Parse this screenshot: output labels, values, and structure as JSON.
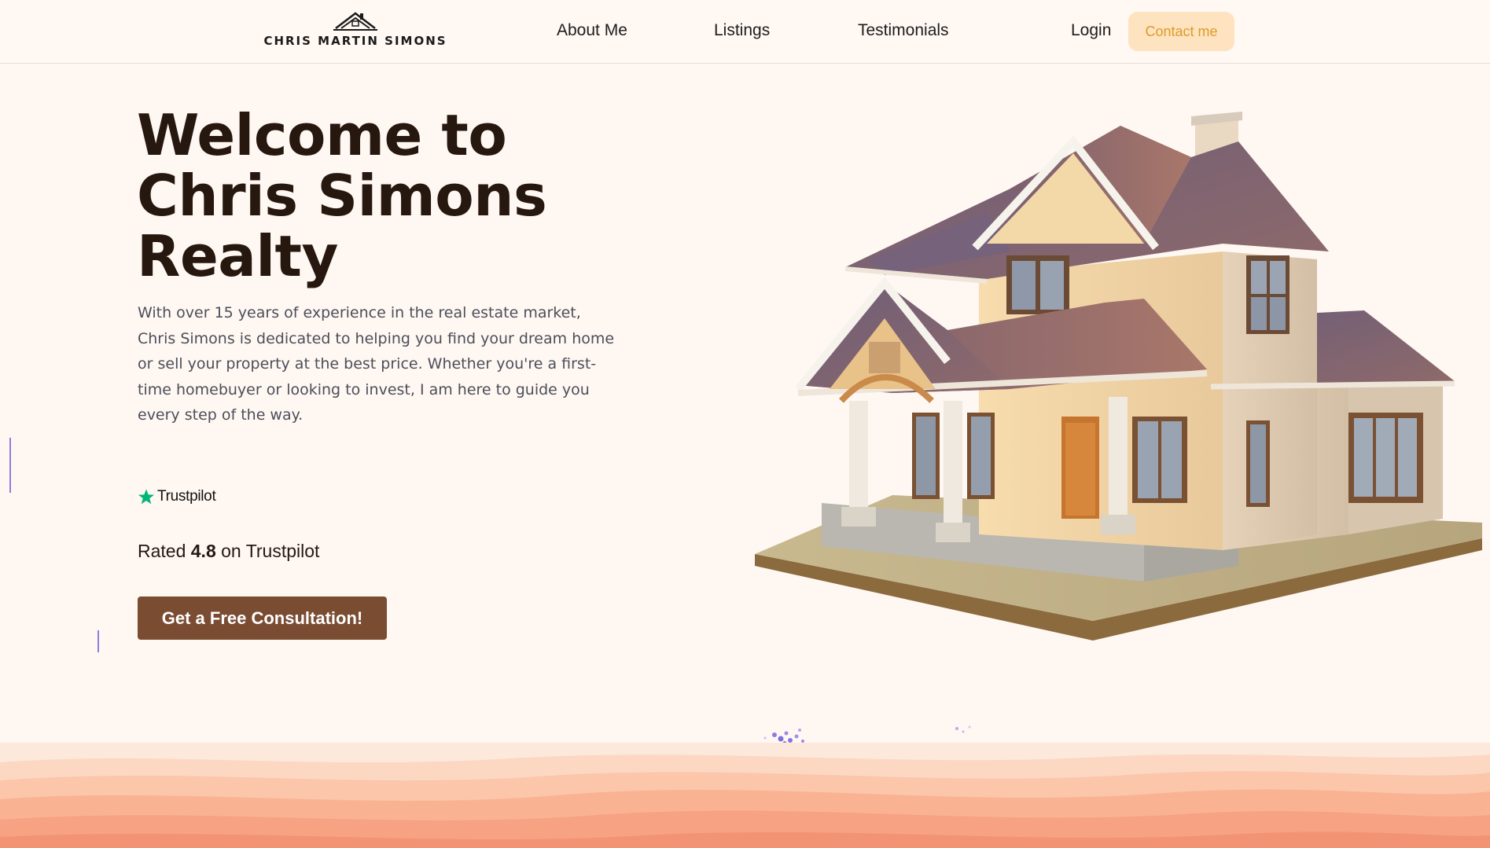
{
  "header": {
    "logo_text": "CHRIS MARTIN SIMONS",
    "nav": {
      "about": "About Me",
      "listings": "Listings",
      "testimonials": "Testimonials",
      "login": "Login"
    },
    "contact_label": "Contact me"
  },
  "hero": {
    "title_line1": "Welcome to",
    "title_line2": "Chris Simons",
    "title_line3": "Realty",
    "description": "With over 15 years of experience in the real estate market, Chris Simons is dedicated to helping you find your dream home or sell your property at the best price. Whether you're a first-time homebuyer or looking to invest, I am here to guide you every step of the way.",
    "trustpilot_label": "Trustpilot",
    "rating_prefix": "Rated ",
    "rating_value": "4.8",
    "rating_suffix": " on Trustpilot",
    "cta_label": "Get a Free Consultation!"
  },
  "colors": {
    "background": "#fff7f2",
    "contact_bg": "#fde3bf",
    "contact_text": "#e09a2a",
    "cta_bg": "#7a4d33",
    "trustpilot_green": "#00b67a"
  },
  "icons": {
    "logo": "house-roof-icon",
    "trustpilot": "star-icon"
  }
}
